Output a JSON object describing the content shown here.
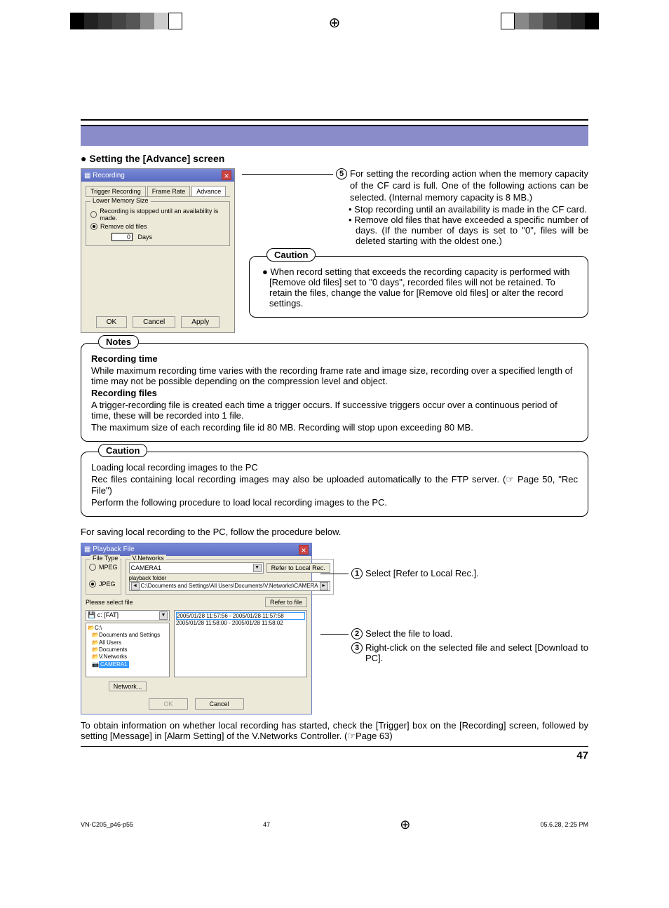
{
  "print": {
    "file": "VN-C205_p46-p55",
    "sheet_page": "47",
    "timestamp": "05.6.28, 2:25 PM"
  },
  "page_number": "47",
  "section_title": "Setting the [Advance] screen",
  "dialog_recording": {
    "title": "Recording",
    "tabs": {
      "t1": "Trigger Recording",
      "t2": "Frame Rate",
      "t3": "Advance"
    },
    "group_label": "Lower Memory Size",
    "radio1": "Recording is stopped until an availability is made.",
    "radio2": "Remove old files",
    "days_value": "0",
    "days_label": "Days",
    "btn_ok": "OK",
    "btn_cancel": "Cancel",
    "btn_apply": "Apply"
  },
  "step5": {
    "num": "5",
    "text": "For setting the recording action when the memory capacity of the CF card is full. One of the following actions can be selected. (Internal memory capacity is 8 MB.)",
    "sub1": "Stop recording until an availability is made in the CF card.",
    "sub2": "Remove old files that have exceeded a specific number of days. (If the number of days is set to \"0\", files will be deleted starting with the oldest one.)"
  },
  "caution1": {
    "label": "Caution",
    "text": "When record setting that exceeds the recording capacity is performed with [Remove old files] set to \"0 days\", recorded files will not be retained. To retain the files, change the value for [Remove old files] or alter the record settings."
  },
  "notes": {
    "label": "Notes",
    "h1": "Recording time",
    "p1": "While maximum recording time varies with the recording frame rate and image size, recording over a specified length of time may not be possible depending on the compression level and object.",
    "h2": "Recording files",
    "p2": "A trigger-recording file is created each time a trigger occurs. If successive triggers occur over a continuous period of time, these will be recorded into 1 file.",
    "p3": "The maximum size of each recording file id 80 MB. Recording will stop upon exceeding 80 MB."
  },
  "caution2": {
    "label": "Caution",
    "line1": "Loading local recording images to the PC",
    "line2": "Rec files containing local recording images may also be uploaded automatically to the FTP server. (☞ Page 50, \"Rec File\")",
    "line3": "Perform the following procedure to load local recording images to the PC."
  },
  "intro_line": "For saving local recording to the PC, follow the procedure below.",
  "dialog_playback": {
    "title": "Playback File",
    "file_type_label": "File Type",
    "mpeg": "MPEG",
    "jpeg": "JPEG",
    "vnetworks_label": "V.Networks",
    "camera_dropdown": "CAMERA1",
    "refer_local_btn": "Refer to Local Rec.",
    "pbfolder": "playback folder",
    "path": "C:\\Documents and Settings\\All Users\\Documents\\V.Networks\\CAMERA",
    "please_select": "Please select file",
    "refer_file_btn": "Refer to file",
    "drive": "c: [FAT]",
    "file1": "2005/01/28 11:57:56 - 2005/01/28 11:57:58",
    "file2": "2005/01/28 11:58:00 - 2005/01/28 11:58:02",
    "tree": {
      "n1": "C:\\",
      "n2": "Documents and Settings",
      "n3": "All Users",
      "n4": "Documents",
      "n5": "V.Networks",
      "n6": "CAMERA1"
    },
    "network_btn": "Network...",
    "ok": "OK",
    "cancel": "Cancel"
  },
  "steps_right": {
    "s1n": "1",
    "s1": "Select [Refer to Local Rec.].",
    "s2n": "2",
    "s2": "Select the file to load.",
    "s3n": "3",
    "s3": "Right-click on the selected file and select [Download to PC]."
  },
  "footer_text": "To obtain information on whether local recording has started, check the [Trigger] box on the [Recording] screen, followed by setting [Message] in [Alarm Setting] of the V.Networks Controller. (☞Page 63)"
}
